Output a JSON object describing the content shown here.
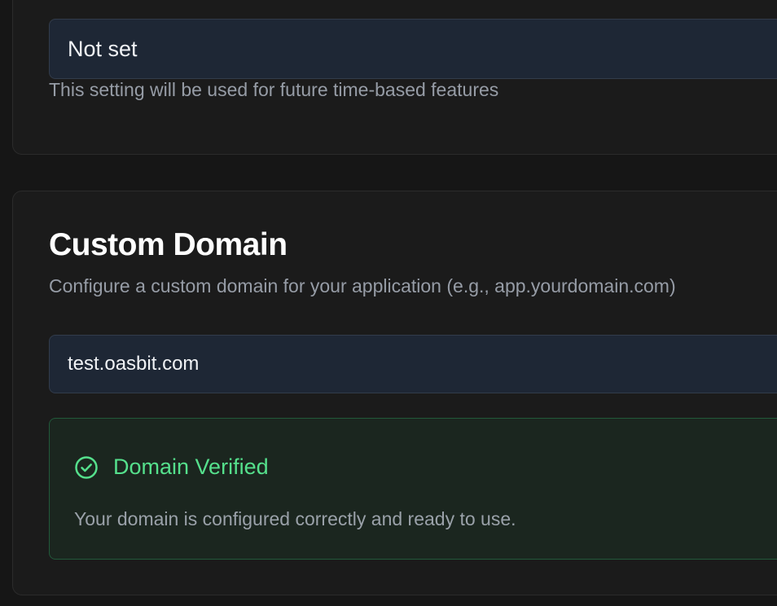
{
  "timezone": {
    "value": "Not set",
    "help": "This setting will be used for future time-based features"
  },
  "custom_domain": {
    "title": "Custom Domain",
    "description": "Configure a custom domain for your application (e.g., app.yourdomain.com)",
    "input_value": "test.oasbit.com",
    "status": {
      "icon": "check-circle-icon",
      "title": "Domain Verified",
      "message": "Your domain is configured correctly and ready to use.",
      "color": "#55e08c",
      "border_color": "#22593a",
      "background": "#1b261f"
    }
  },
  "colors": {
    "page_background": "#161616",
    "card_background": "#1b1b1b",
    "input_background": "#1e2735"
  }
}
